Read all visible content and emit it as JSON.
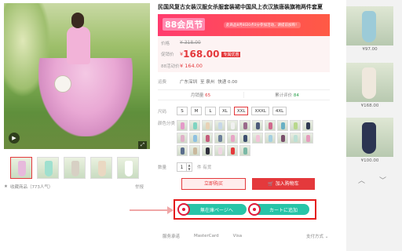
{
  "product": {
    "title": "民国风复古女装汉服女杀服套装裙中国风上衣汉族唐装旗袍两件套夏",
    "favorites": "收藏商品（773人气）",
    "report": "举报"
  },
  "promo": {
    "badge": "88会员节",
    "note": "此商品8月8日0点0分参加活动，请提前加购！"
  },
  "price": {
    "label_orig": "价格",
    "orig": "¥ 318.00",
    "label_now": "促销价",
    "yen": "¥",
    "now": "168.00",
    "tag": "专属优惠",
    "label_dep": "88活动价",
    "dep": "¥ 164.00"
  },
  "shipping": {
    "label": "运费",
    "from": "广东深圳",
    "to": "至 泉州",
    "fee": "快递 0.00"
  },
  "stats": {
    "sales_label": "月销量",
    "sales": "65",
    "reviews_label": "累计评价",
    "reviews": "84"
  },
  "options": {
    "size_label": "尺码",
    "sizes": [
      "S",
      "M",
      "L",
      "XL",
      "XXL",
      "XXXL",
      "4XL"
    ],
    "selected_size": "XXL",
    "color_label": "颜色分类"
  },
  "quantity": {
    "label": "数量",
    "value": "1",
    "up": "▲",
    "down": "▼",
    "stock": "件  有货"
  },
  "actions": {
    "buy_now": "立即购买",
    "add_cart": "加入购物车"
  },
  "highlight": {
    "btn1": "無在庫ページへ",
    "btn2": "カートに追加"
  },
  "payment": {
    "label": "服务承诺",
    "methods": [
      "MasterCard",
      "Visa"
    ],
    "more": "支付方式 ⌄"
  },
  "recommend": {
    "prices": [
      "¥97.00",
      "¥168.00",
      "¥100.00"
    ],
    "up": "︿",
    "down": "﹀"
  },
  "media": {
    "play": "▶",
    "zoom": "⤢"
  },
  "colors": {
    "accent": "#e4393c",
    "teal": "#27c4a8",
    "highlight": "#e41b1b"
  }
}
